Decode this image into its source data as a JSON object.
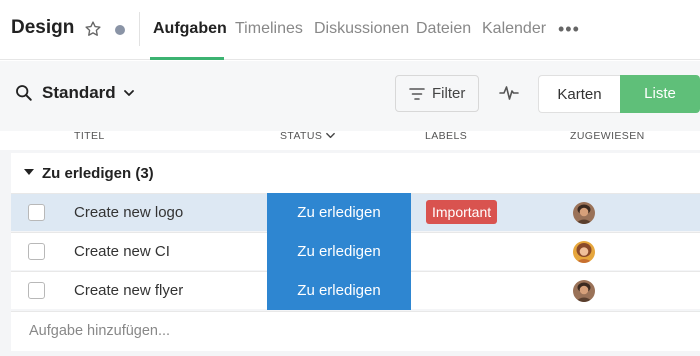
{
  "project": {
    "title": "Design"
  },
  "tabs": [
    {
      "label": "Aufgaben",
      "active": true
    },
    {
      "label": "Timelines"
    },
    {
      "label": "Diskussionen"
    },
    {
      "label": "Dateien"
    },
    {
      "label": "Kalender"
    }
  ],
  "more_label": "•••",
  "toolbar": {
    "view_name": "Standard",
    "filter_label": "Filter",
    "view_toggle": {
      "cards_label": "Karten",
      "list_label": "Liste",
      "active": "Liste"
    }
  },
  "columns": {
    "title": "TITEL",
    "status": "STATUS",
    "labels": "LABELS",
    "assigned": "ZUGEWIESEN"
  },
  "group": {
    "title": "Zu erledigen (3)"
  },
  "rows": [
    {
      "title": "Create new logo",
      "status": "Zu erledigen",
      "label": "Important",
      "selected": true,
      "avatar": "avatar-1"
    },
    {
      "title": "Create new CI",
      "status": "Zu erledigen",
      "label": "",
      "selected": false,
      "avatar": "avatar-2"
    },
    {
      "title": "Create new flyer",
      "status": "Zu erledigen",
      "label": "",
      "selected": false,
      "avatar": "avatar-1"
    }
  ],
  "add_task_placeholder": "Aufgabe hinzufügen...",
  "colors": {
    "accent_green": "#3cb371",
    "list_button": "#5fbf79",
    "status_blue": "#2e86d1",
    "label_red": "#d9534f",
    "selected_row": "#dde8f3"
  },
  "icons": [
    "star-icon",
    "status-dot-icon",
    "search-icon",
    "chevron-down-icon",
    "filter-icon",
    "activity-pulse-icon",
    "caret-down-icon",
    "checkbox-icon",
    "avatar"
  ]
}
